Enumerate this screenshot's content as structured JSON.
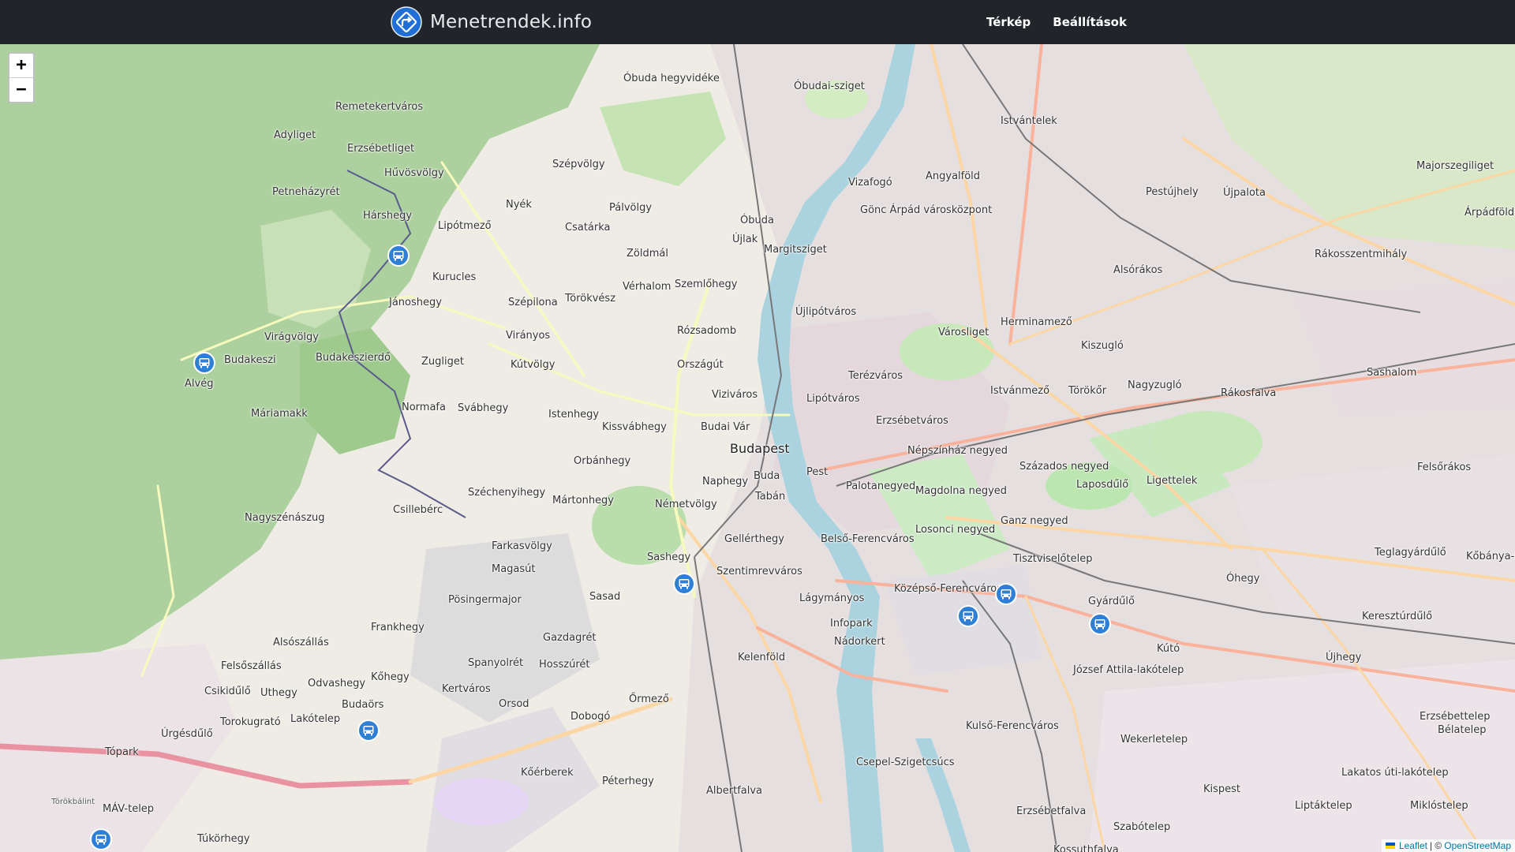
{
  "navbar": {
    "brand_name": "Menetrendek.info",
    "links": [
      {
        "label": "Térkép"
      },
      {
        "label": "Beállítások"
      }
    ]
  },
  "map": {
    "zoom_in_label": "+",
    "zoom_out_label": "−",
    "attribution": {
      "leaflet": "Leaflet",
      "separator": "| ©",
      "osm": "OpenStreetMap"
    },
    "places": [
      "Budapest",
      "Óbuda",
      "Buda",
      "Pest",
      "Tabán",
      "Budai Vár",
      "Újlak",
      "Vizafogó",
      "Angyalföld",
      "Margitsziget",
      "Újlipótváros",
      "Lipótváros",
      "Terézváros",
      "Városliget",
      "Erzsébetváros",
      "Népszínház negyed",
      "Palotanegyed",
      "Magdolna negyed",
      "Losonci negyed",
      "Ganz negyed",
      "Belső-Ferencváros",
      "Középső-Ferencváros",
      "Tisztviselőtelep",
      "Lágymányos",
      "Infopark",
      "Nádorkert",
      "Kelenföld",
      "Gellérthegy",
      "Szentimrevváros",
      "Naphegy",
      "Németvölgy",
      "Sashegy",
      "Orbánhegy",
      "Mártonhegy",
      "Kissvábhegy",
      "Istenhegy",
      "Viziváros",
      "Országút",
      "Rózsadomb",
      "Szemlőhegy",
      "Vérhalom",
      "Zöldmál",
      "Törökvész",
      "Csatárka",
      "Pálvölgy",
      "Szépvölgy",
      "Nyék",
      "Lipótmező",
      "Kurucles",
      "Hárshegy",
      "Hűvösvölgy",
      "Erzsébetliget",
      "Remetekertváros",
      "Adyliget",
      "Petneházyrét",
      "Jánoshegy",
      "Szépilona",
      "Virányos",
      "Kútvölgy",
      "Zugliget",
      "Svábhegy",
      "Normafa",
      "Budakeszierdő",
      "Virágvölgy",
      "Budakeszi",
      "Alvég",
      "Máriamakk",
      "Széchenyihegy",
      "Csillebérc",
      "Nagyszénászug",
      "Farkasvölgy",
      "Magasút",
      "Sasad",
      "Gazdagrét",
      "Hosszúrét",
      "Spanyolrét",
      "Pösingermajor",
      "Frankhegy",
      "Naphegy",
      "Alsószállás",
      "Felsőszállás",
      "Odvashegy",
      "Kőhegy",
      "Kertváros",
      "Csikidűlő",
      "Uthegy",
      "Lakótelep",
      "Budaörs",
      "Torokugrató",
      "Úrgésdűlő",
      "Törökbálint",
      "Tópark",
      "MÁV-telep",
      "Túkörhegy",
      "Orsod",
      "Dobogó",
      "Őrmező",
      "Kőérberek",
      "Péterhegy",
      "Albertfalva",
      "Csepel-Szigetcsúcs",
      "Kulső-Ferencváros",
      "József Attila-lakótelep",
      "Gyárdűlő",
      "Kútó",
      "Wekerletelep",
      "Kispest",
      "Erzsébetfalva",
      "Szabótelep",
      "Kossuthfalva",
      "Liptáktelep",
      "Lakatos úti-lakótelep",
      "Miklóstelep",
      "Bélatelep",
      "Erzsébettelep",
      "Újhegy",
      "Keresztúrdűlő",
      "Óhegy",
      "Laposdűlő",
      "Ligettelek",
      "Százados negyed",
      "Istvánmező",
      "Törökőr",
      "Kiszugló",
      "Herminamező",
      "Nagyzugló",
      "Rákosfalva",
      "Sashalom",
      "Alsórákos",
      "Rákosszentmihály",
      "Pestújhely",
      "Újpalota",
      "Istvántelek",
      "Óbudai-sziget",
      "Óbuda hegyvidéke",
      "Gönc Árpád városközpont",
      "Majorszegiliget",
      "Árpádföld",
      "Felsőrákos",
      "Teglagyárdűlő",
      "Kőbánya-Kertváros"
    ],
    "markers": [
      {
        "name": "bus-stop-kurucles"
      },
      {
        "name": "bus-stop-budakeszi"
      },
      {
        "name": "bus-stop-szentimrevaros"
      },
      {
        "name": "bus-stop-kozepso-ferencvaros"
      },
      {
        "name": "bus-stop-nepliget"
      },
      {
        "name": "bus-stop-gyardulo"
      },
      {
        "name": "bus-stop-budaors"
      },
      {
        "name": "bus-stop-torokbalint"
      }
    ]
  }
}
